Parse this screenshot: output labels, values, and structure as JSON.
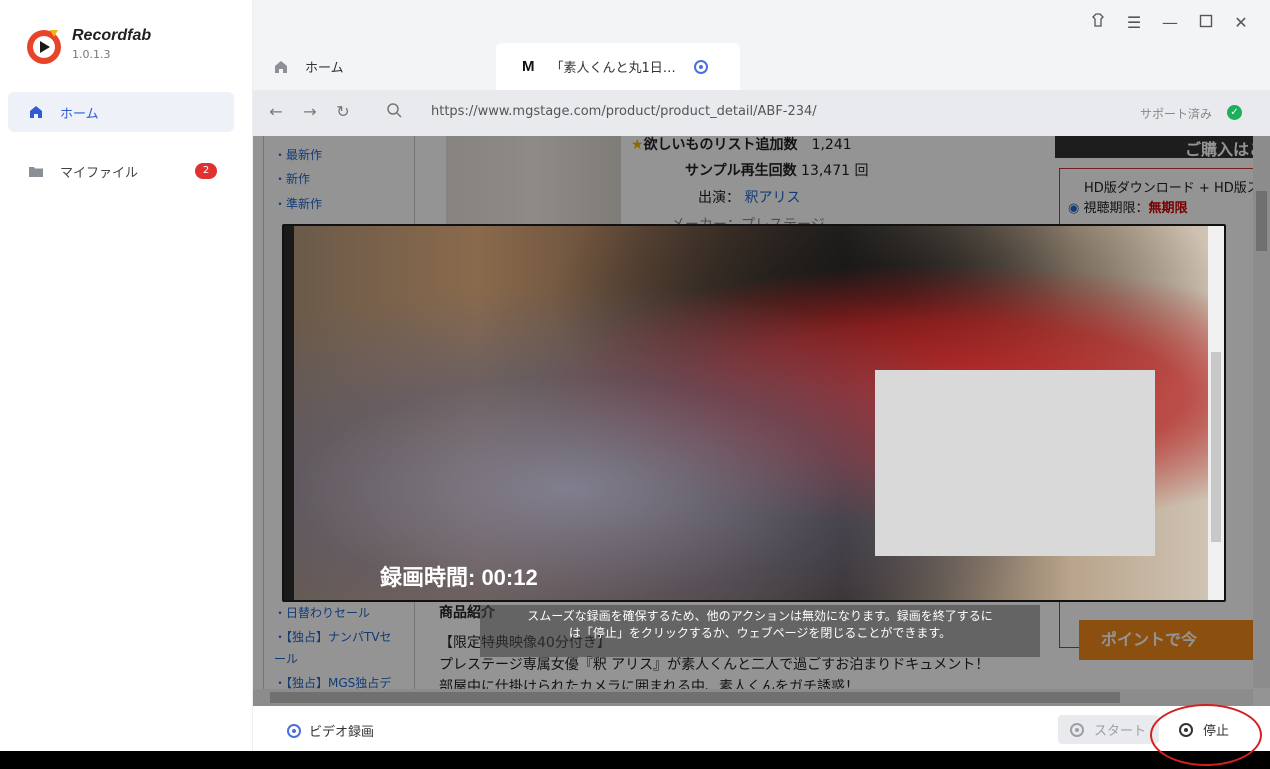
{
  "app": {
    "name": "Recordfab",
    "version": "1.0.1.3"
  },
  "sidebar": {
    "items": [
      {
        "label": "ホーム",
        "icon": "home-icon",
        "active": true
      },
      {
        "label": "マイファイル",
        "icon": "folder-icon",
        "badge": "2"
      }
    ]
  },
  "tabs": [
    {
      "label": "ホーム",
      "icon": "home-icon"
    },
    {
      "label": "「素人くんと丸1日…",
      "icon": "mgstage-logo-icon",
      "favicon_text": "M"
    }
  ],
  "address_bar": {
    "url": "https://www.mgstage.com/product/product_detail/ABF-234/",
    "support_label": "サポート済み"
  },
  "web": {
    "left_menu": [
      "最新作",
      "新作",
      "準新作"
    ],
    "left_menu_bottom": [
      "日替わりセール",
      "【独占】ナンパTVセ",
      "ール",
      "【独占】MGS独占デ"
    ],
    "wishlist_label": "欲しいものリスト追加数",
    "wishlist_count": "1,241",
    "sample_label": "サンプル再生回数",
    "sample_count": "13,471",
    "sample_unit": "回",
    "cast_label": "出演：",
    "cast_name": "釈アリス",
    "maker_partial": "メーカー：プレステージ",
    "right_header": "ご購入はこち",
    "right_option": "HD版ダウンロード + HD版ス",
    "right_period_label": "視聴期限：",
    "right_period_value": "無期限",
    "right_points_btn": "ポイントで今",
    "product_intro": "商品紹介",
    "desc_line1": "【限定特典映像40分付き】",
    "desc_line2": "プレステージ専属女優『釈 アリス』が素人くんと二人で過ごすお泊まりドキュメント！",
    "desc_line3": "部屋中に仕掛けられたカメラに囲まれる中、素人くんをガチ誘惑！"
  },
  "recording": {
    "time_label": "録画時間: 00:12",
    "notice_line1": "スムーズな録画を確保するため、他のアクションは無効になります。録画を終了するに",
    "notice_line2": "は「停止」をクリックするか、ウェブページを閉じることができます。"
  },
  "bottom_bar": {
    "mode_label": "ビデオ録画",
    "start_label": "スタート",
    "stop_label": "停止"
  },
  "colors": {
    "accent": "#2f5bd8",
    "badge": "#e03131",
    "highlight": "#d42020",
    "support_check": "#1fae5b"
  }
}
